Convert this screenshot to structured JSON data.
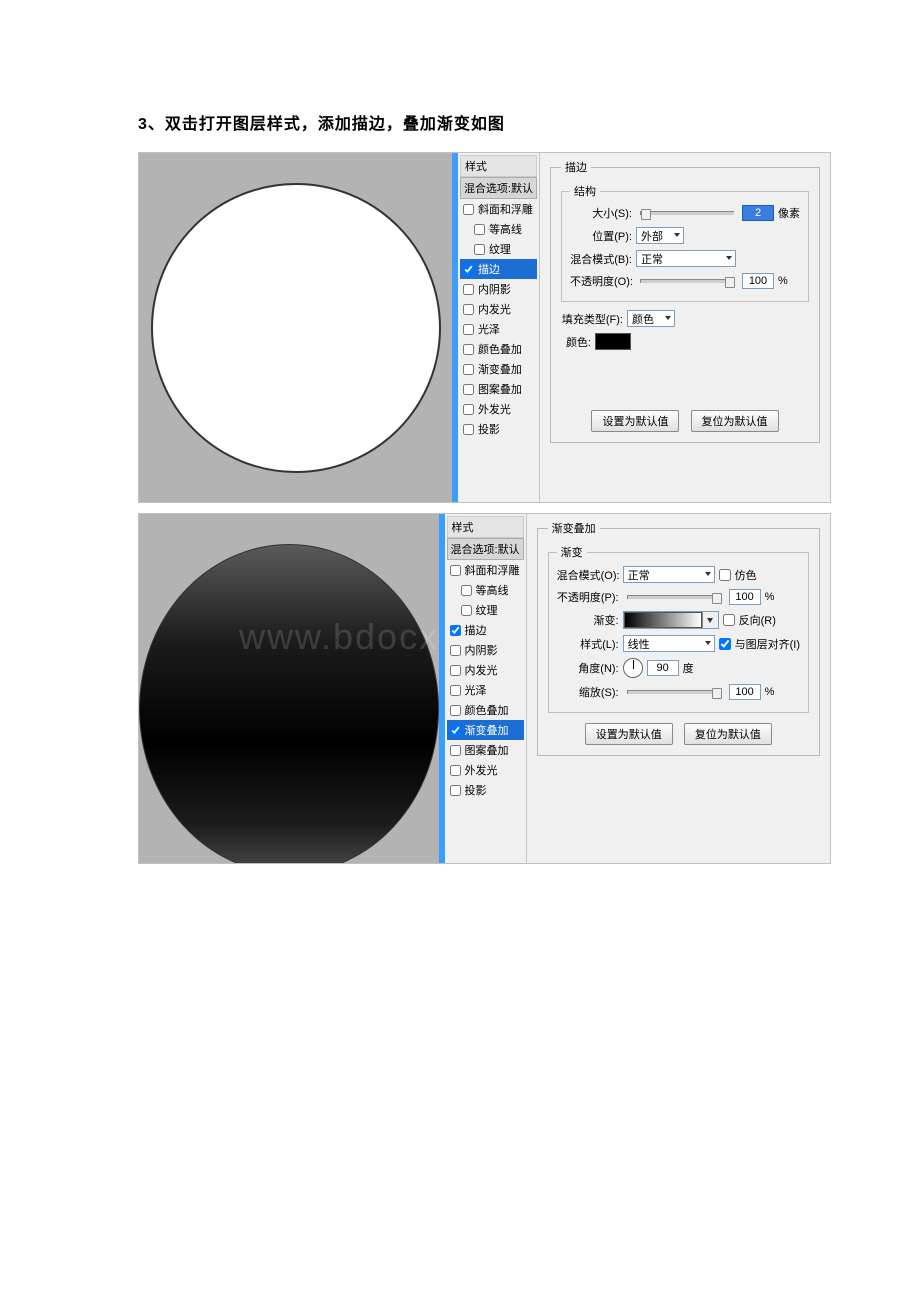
{
  "heading": "3、双击打开图层样式，添加描边，叠加渐变如图",
  "watermark": "www.bdocx.com",
  "styles_header": "样式",
  "blend_options": "混合选项:默认",
  "style_items": [
    {
      "label": "斜面和浮雕",
      "checked": false
    },
    {
      "label": "等高线",
      "checked": false,
      "indent": true
    },
    {
      "label": "纹理",
      "checked": false,
      "indent": true
    },
    {
      "label": "描边",
      "checked": true
    },
    {
      "label": "内阴影",
      "checked": false
    },
    {
      "label": "内发光",
      "checked": false
    },
    {
      "label": "光泽",
      "checked": false
    },
    {
      "label": "颜色叠加",
      "checked": false
    },
    {
      "label": "渐变叠加",
      "checked": false
    },
    {
      "label": "图案叠加",
      "checked": false
    },
    {
      "label": "外发光",
      "checked": false
    },
    {
      "label": "投影",
      "checked": false
    }
  ],
  "stroke": {
    "group_title": "描边",
    "structure_title": "结构",
    "size_label": "大小(S):",
    "size_value": "2",
    "size_unit": "像素",
    "position_label": "位置(P):",
    "position_value": "外部",
    "blend_label": "混合模式(B):",
    "blend_value": "正常",
    "opacity_label": "不透明度(O):",
    "opacity_value": "100",
    "percent": "%",
    "fill_type_label": "填充类型(F):",
    "fill_type_value": "颜色",
    "color_label": "颜色:",
    "btn_default": "设置为默认值",
    "btn_reset": "复位为默认值"
  },
  "gradient": {
    "group_title": "渐变叠加",
    "sub_title": "渐变",
    "blend_label": "混合模式(O):",
    "blend_value": "正常",
    "dither_label": "仿色",
    "opacity_label": "不透明度(P):",
    "opacity_value": "100",
    "percent": "%",
    "gradient_label": "渐变:",
    "reverse_label": "反向(R)",
    "style_label": "样式(L):",
    "style_value": "线性",
    "align_label": "与图层对齐(I)",
    "angle_label": "角度(N):",
    "angle_value": "90",
    "angle_unit": "度",
    "scale_label": "缩放(S):",
    "scale_value": "100",
    "btn_default": "设置为默认值",
    "btn_reset": "复位为默认值"
  }
}
